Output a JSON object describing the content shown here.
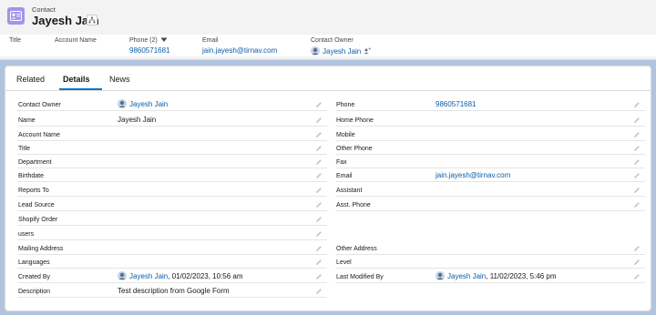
{
  "header": {
    "entity": "Contact",
    "name": "Jayesh Jain"
  },
  "highlights": [
    {
      "key": "title",
      "label": "Title",
      "value": ""
    },
    {
      "key": "account_name",
      "label": "Account Name",
      "value": ""
    },
    {
      "key": "phone",
      "label": "Phone (2)",
      "value": "9860571681"
    },
    {
      "key": "email",
      "label": "Email",
      "value": "jain.jayesh@tirnav.com"
    },
    {
      "key": "owner",
      "label": "Contact Owner",
      "value": "Jayesh Jain"
    }
  ],
  "tabs": [
    "Related",
    "Details",
    "News"
  ],
  "active_tab": "Details",
  "details": {
    "left": [
      {
        "label": "Contact Owner",
        "value": "Jayesh Jain",
        "link": true,
        "avatar": true
      },
      {
        "label": "Name",
        "value": "Jayesh Jain"
      },
      {
        "label": "Account Name",
        "value": ""
      },
      {
        "label": "Title",
        "value": ""
      },
      {
        "label": "Department",
        "value": ""
      },
      {
        "label": "Birthdate",
        "value": ""
      },
      {
        "label": "Reports To",
        "value": ""
      },
      {
        "label": "Lead Source",
        "value": ""
      },
      {
        "label": "Shopify Order",
        "value": ""
      },
      {
        "label": "users",
        "value": ""
      },
      {
        "label": "Mailing Address",
        "value": ""
      },
      {
        "label": "Languages",
        "value": ""
      },
      {
        "label": "Created By",
        "value": "Jayesh Jain",
        "suffix": ", 01/02/2023, 10:56 am",
        "link": true,
        "avatar": true
      },
      {
        "label": "Description",
        "value": "Test description from Google Form"
      }
    ],
    "right": [
      {
        "label": "Phone",
        "value": "9860571681",
        "link": true
      },
      {
        "label": "Home Phone",
        "value": ""
      },
      {
        "label": "Mobile",
        "value": ""
      },
      {
        "label": "Other Phone",
        "value": ""
      },
      {
        "label": "Fax",
        "value": ""
      },
      {
        "label": "Email",
        "value": "jain.jayesh@tirnav.com",
        "link": true
      },
      {
        "label": "Assistant",
        "value": ""
      },
      {
        "label": "Asst. Phone",
        "value": ""
      },
      {
        "label": "Other Address",
        "value": ""
      },
      {
        "label": "Level",
        "value": ""
      },
      {
        "label": "Last Modified By",
        "value": "Jayesh Jain",
        "suffix": ", 11/02/2023, 5:46 pm",
        "link": true,
        "avatar": true
      }
    ]
  },
  "colors": {
    "link": "#0b5cab",
    "contact_icon_bg": "#a094ed",
    "tab_accent": "#0176d3",
    "page_bg": "#b0c4df"
  },
  "icons": {
    "contact": "contact-card-icon",
    "hierarchy": "hierarchy-icon",
    "phone_dropdown": "chevron-down-icon",
    "avatar": "user-avatar-icon",
    "edit": "pencil-icon",
    "change_owner": "change-owner-icon"
  }
}
